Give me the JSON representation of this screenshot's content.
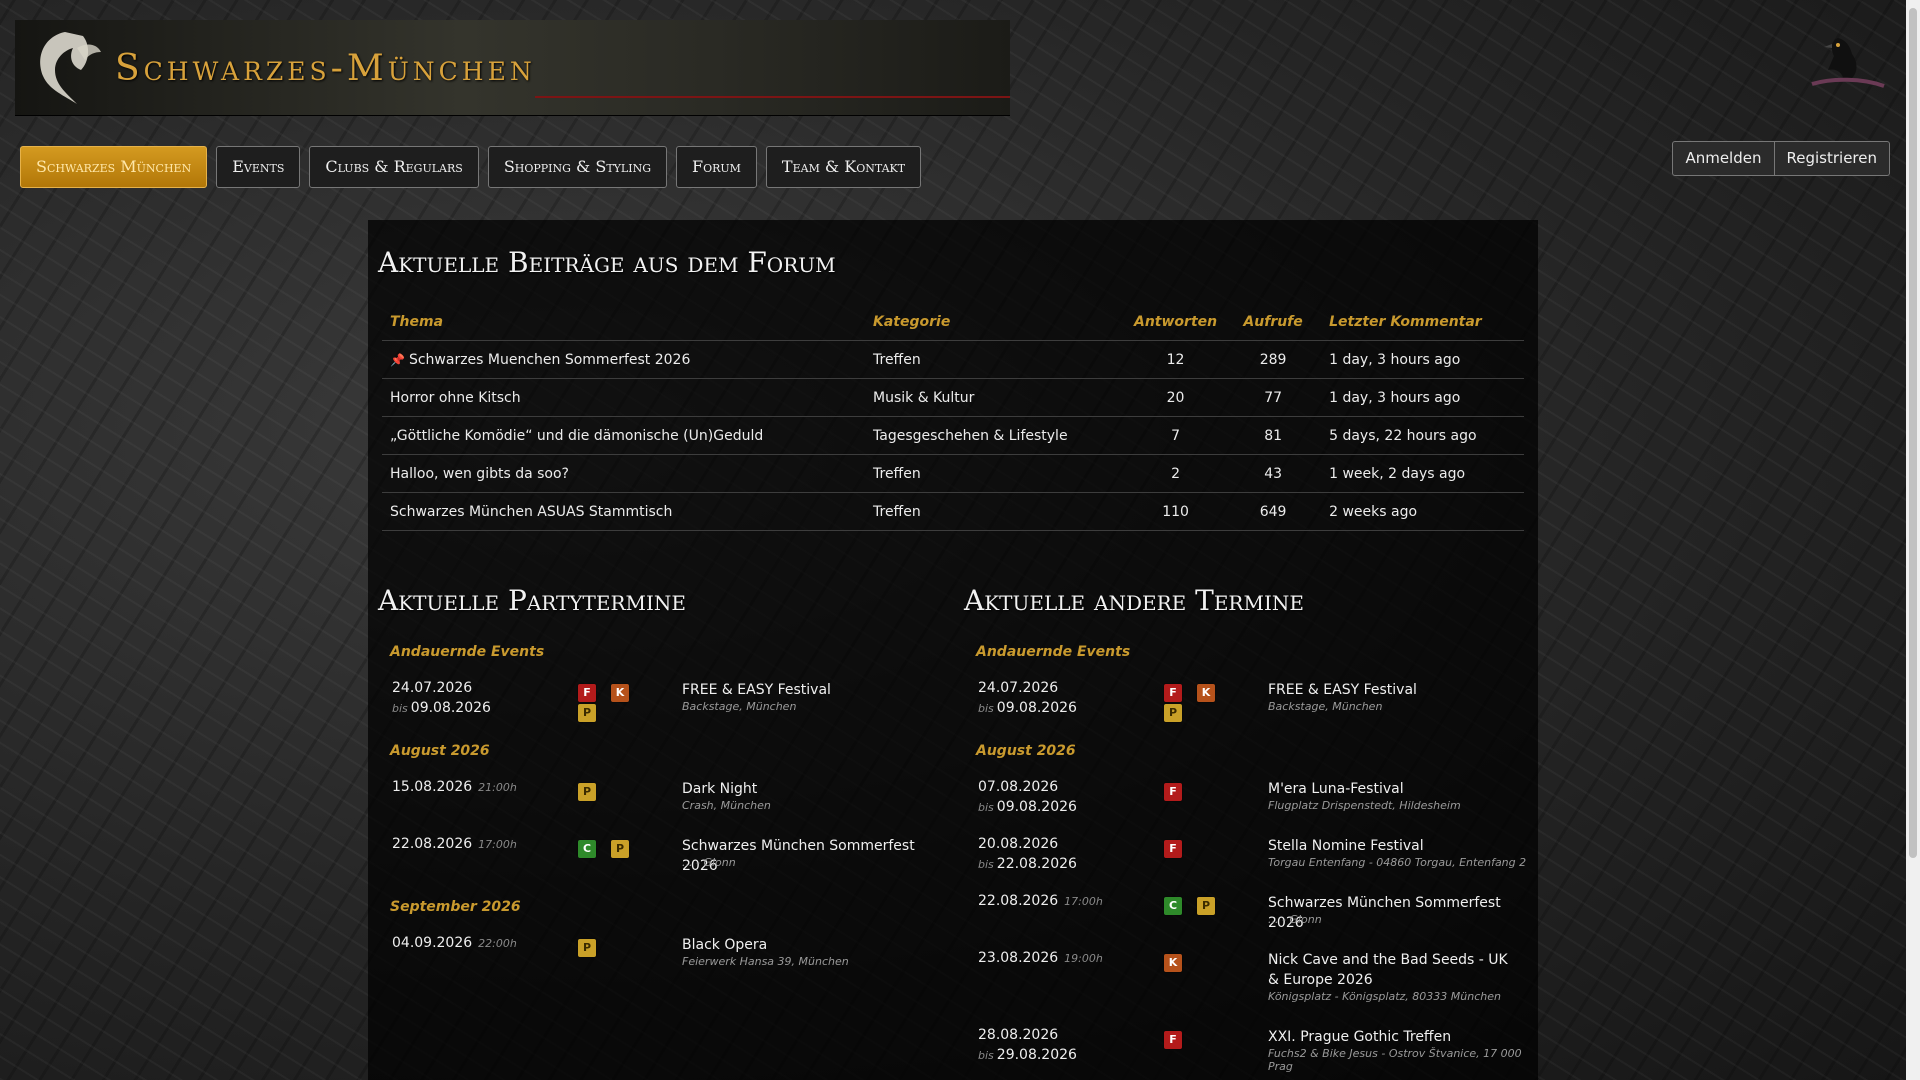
{
  "header": {
    "site_title": "Schwarzes-München",
    "logo_icon": "dragon-icon",
    "mascot_icon": "raven-icon"
  },
  "nav": {
    "items": [
      {
        "label": "Schwarzes München",
        "active": true
      },
      {
        "label": "Events",
        "active": false
      },
      {
        "label": "Clubs & Regulars",
        "active": false
      },
      {
        "label": "Shopping & Styling",
        "active": false
      },
      {
        "label": "Forum",
        "active": false
      },
      {
        "label": "Team & Kontakt",
        "active": false
      }
    ],
    "login_label": "Anmelden",
    "register_label": "Registrieren"
  },
  "forum": {
    "heading": "Aktuelle Beiträge aus dem Forum",
    "columns": {
      "topic": "Thema",
      "category": "Kategorie",
      "replies": "Antworten",
      "views": "Aufrufe",
      "last": "Letzter Kommentar"
    },
    "rows": [
      {
        "pinned": "📌",
        "topic": "Schwarzes Muenchen Sommerfest 2026",
        "category": "Treffen",
        "replies": "12",
        "views": "289",
        "last": "1 day, 3 hours ago"
      },
      {
        "pinned": "",
        "topic": "Horror ohne Kitsch",
        "category": "Musik & Kultur",
        "replies": "20",
        "views": "77",
        "last": "1 day, 3 hours ago"
      },
      {
        "pinned": "",
        "topic": "„Göttliche Komödie“ und die dämonische (Un)Geduld",
        "category": "Tagesgeschehen & Lifestyle",
        "replies": "7",
        "views": "81",
        "last": "5 days, 22 hours ago"
      },
      {
        "pinned": "",
        "topic": "Halloo, wen gibts da soo?",
        "category": "Treffen",
        "replies": "2",
        "views": "43",
        "last": "1 week, 2 days ago"
      },
      {
        "pinned": "",
        "topic": "Schwarzes München ASUAS Stammtisch",
        "category": "Treffen",
        "replies": "110",
        "views": "649",
        "last": "2 weeks ago"
      }
    ]
  },
  "party": {
    "heading": "Aktuelle Partytermine",
    "groups": [
      {
        "title": "Andauernde Events",
        "events": [
          {
            "date": "24.07.2026",
            "time": "",
            "until_prefix": "bis",
            "until": "09.08.2026",
            "tags": [
              "F",
              "K",
              "P"
            ],
            "name": "FREE & EASY Festival",
            "location": "Backstage, München"
          }
        ]
      },
      {
        "title": "August 2026",
        "events": [
          {
            "date": "15.08.2026",
            "time": "21:00h",
            "until_prefix": "",
            "until": "",
            "tags": [
              "P"
            ],
            "name": "Dark Night",
            "location": "Crash, München"
          },
          {
            "date": "22.08.2026",
            "time": "17:00h",
            "until_prefix": "",
            "until": "",
            "tags": [
              "C",
              "P"
            ],
            "name": "Schwarzes München Sommerfest 2026",
            "location": "... - Glonn"
          }
        ]
      },
      {
        "title": "September 2026",
        "events": [
          {
            "date": "04.09.2026",
            "time": "22:00h",
            "until_prefix": "",
            "until": "",
            "tags": [
              "P"
            ],
            "name": "Black Opera",
            "location": "Feierwerk Hansa 39, München"
          }
        ]
      }
    ]
  },
  "other": {
    "heading": "Aktuelle andere Termine",
    "groups": [
      {
        "title": "Andauernde Events",
        "events": [
          {
            "date": "24.07.2026",
            "time": "",
            "until_prefix": "bis",
            "until": "09.08.2026",
            "tags": [
              "F",
              "K",
              "P"
            ],
            "name": "FREE & EASY Festival",
            "location": "Backstage, München"
          }
        ]
      },
      {
        "title": "August 2026",
        "events": [
          {
            "date": "07.08.2026",
            "time": "",
            "until_prefix": "bis",
            "until": "09.08.2026",
            "tags": [
              "F"
            ],
            "name": "M'era Luna-Festival",
            "location": "Flugplatz Drispenstedt, Hildesheim"
          },
          {
            "date": "20.08.2026",
            "time": "",
            "until_prefix": "bis",
            "until": "22.08.2026",
            "tags": [
              "F"
            ],
            "name": "Stella Nomine Festival",
            "location": "Torgau Entenfang - 04860 Torgau, Entenfang 2"
          },
          {
            "date": "22.08.2026",
            "time": "17:00h",
            "until_prefix": "",
            "until": "",
            "tags": [
              "C",
              "P"
            ],
            "name": "Schwarzes München Sommerfest 2026",
            "location": "... - Glonn"
          },
          {
            "date": "23.08.2026",
            "time": "19:00h",
            "until_prefix": "",
            "until": "",
            "tags": [
              "K"
            ],
            "name": "Nick Cave and the Bad Seeds - UK & Europe 2026",
            "location": "Königsplatz - Königsplatz, 80333 München"
          },
          {
            "date": "28.08.2026",
            "time": "",
            "until_prefix": "bis",
            "until": "29.08.2026",
            "tags": [
              "F"
            ],
            "name": "XXI. Prague Gothic Treffen",
            "location": "Fuchs2 & Bike Jesus - Ostrov Štvanice, 17 000 Prag"
          }
        ]
      }
    ]
  },
  "colors": {
    "accent_gold": "#c99a2e",
    "active_nav": "#d49a20",
    "tag_F": "#b31b1b",
    "tag_K": "#b6521b",
    "tag_P": "#caa128",
    "tag_C": "#2e8a2a"
  }
}
